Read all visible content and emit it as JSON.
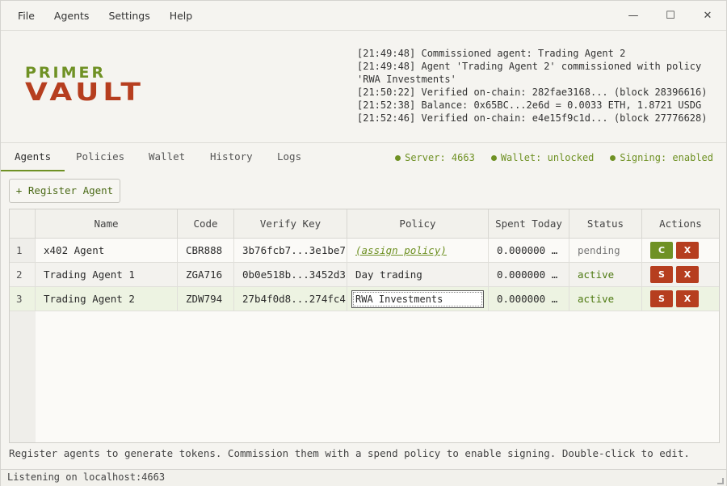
{
  "menu": {
    "file": "File",
    "agents": "Agents",
    "settings": "Settings",
    "help": "Help"
  },
  "window_controls": {
    "minimize": "—",
    "maximize": "☐",
    "close": "✕"
  },
  "logo": {
    "line1": "PRIMER",
    "line2": "VAULT"
  },
  "log": [
    "[21:49:48] Commissioned agent: Trading Agent 2",
    "[21:49:48] Agent 'Trading Agent 2' commissioned with policy",
    "'RWA Investments'",
    "[21:50:22] Verified on-chain: 282fae3168... (block 28396616)",
    "[21:52:38] Balance: 0x65BC...2e6d = 0.0033 ETH, 1.8721 USDG",
    "[21:52:46] Verified on-chain: e4e15f9c1d... (block 27776628)"
  ],
  "tabs": [
    "Agents",
    "Policies",
    "Wallet",
    "History",
    "Logs"
  ],
  "status": {
    "server": "Server: 4663",
    "wallet": "Wallet: unlocked",
    "signing": "Signing: enabled"
  },
  "register_button": "+ Register Agent",
  "table": {
    "headers": [
      "Name",
      "Code",
      "Verify Key",
      "Policy",
      "Spent Today",
      "Status",
      "Actions"
    ],
    "rows": [
      {
        "num": "1",
        "name": "x402 Agent",
        "code": "CBR888",
        "key": "3b76fcb7...3e1be7",
        "policy": "(assign policy)",
        "spent": "0.000000 …",
        "status": "pending",
        "btn1": "C",
        "btn2": "X"
      },
      {
        "num": "2",
        "name": "Trading Agent 1",
        "code": "ZGA716",
        "key": "0b0e518b...3452d3",
        "policy": "Day trading",
        "spent": "0.000000 …",
        "status": "active",
        "btn1": "S",
        "btn2": "X"
      },
      {
        "num": "3",
        "name": "Trading Agent 2",
        "code": "ZDW794",
        "key": "27b4f0d8...274fc4",
        "policy": "RWA Investments",
        "spent": "0.000000 …",
        "status": "active",
        "btn1": "S",
        "btn2": "X"
      }
    ]
  },
  "help_text": "Register agents to generate tokens. Commission them with a spend policy to enable signing. Double-click to edit.",
  "statusbar": "Listening on localhost:4663",
  "colors": {
    "brand_green": "#6f9124",
    "brand_red": "#b63e1f",
    "background": "#f5f4f0"
  }
}
